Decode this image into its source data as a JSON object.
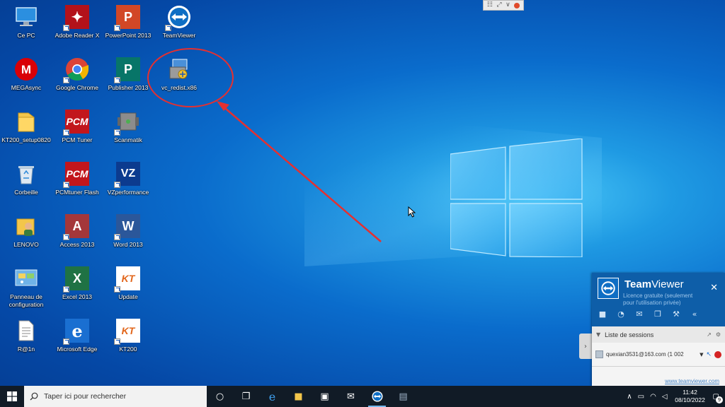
{
  "desktop": {
    "icons": [
      {
        "label": "Ce PC",
        "icon": "computer-icon"
      },
      {
        "label": "Adobe Reader X",
        "icon": "adobe-reader-icon"
      },
      {
        "label": "PowerPoint 2013",
        "icon": "powerpoint-icon"
      },
      {
        "label": "TeamViewer",
        "icon": "teamviewer-icon"
      },
      {
        "label": "MEGAsync",
        "icon": "megasync-icon"
      },
      {
        "label": "Google Chrome",
        "icon": "chrome-icon"
      },
      {
        "label": "Publisher 2013",
        "icon": "publisher-icon"
      },
      {
        "label": "vc_redist.x86",
        "icon": "installer-icon"
      },
      {
        "label": "KT200_setup0820",
        "icon": "folder-icon"
      },
      {
        "label": "PCM Tuner",
        "icon": "pcm-tuner-icon"
      },
      {
        "label": "Scanmatik",
        "icon": "scanmatik-icon"
      },
      {
        "label": "Corbeille",
        "icon": "recycle-bin-icon"
      },
      {
        "label": "PCMtuner Flash",
        "icon": "pcm-flash-icon"
      },
      {
        "label": "VZperformance",
        "icon": "vz-icon"
      },
      {
        "label": "LENOVO",
        "icon": "user-folder-icon"
      },
      {
        "label": "Access 2013",
        "icon": "access-icon"
      },
      {
        "label": "Word 2013",
        "icon": "word-icon"
      },
      {
        "label": "Panneau de configuration",
        "icon": "control-panel-icon"
      },
      {
        "label": "Excel 2013",
        "icon": "excel-icon"
      },
      {
        "label": "Update",
        "icon": "update-icon"
      },
      {
        "label": "R@1n",
        "icon": "text-file-icon"
      },
      {
        "label": "Microsoft Edge",
        "icon": "edge-icon"
      },
      {
        "label": "KT200",
        "icon": "kt200-icon"
      }
    ],
    "annotation_color": "#e53030"
  },
  "teamviewer_panel": {
    "title_bold": "Team",
    "title_rest": "Viewer",
    "subtitle": "Licence gratuite (seulement pour l'utilisation privée)",
    "sessions_label": "Liste de sessions",
    "session_user": "quexian3531@163.com (1 002",
    "footer_link": "www.teamviewer.com"
  },
  "taskbar": {
    "search_placeholder": "Taper ici pour rechercher",
    "time": "11:42",
    "date": "08/10/2022",
    "notification_count": "9"
  }
}
